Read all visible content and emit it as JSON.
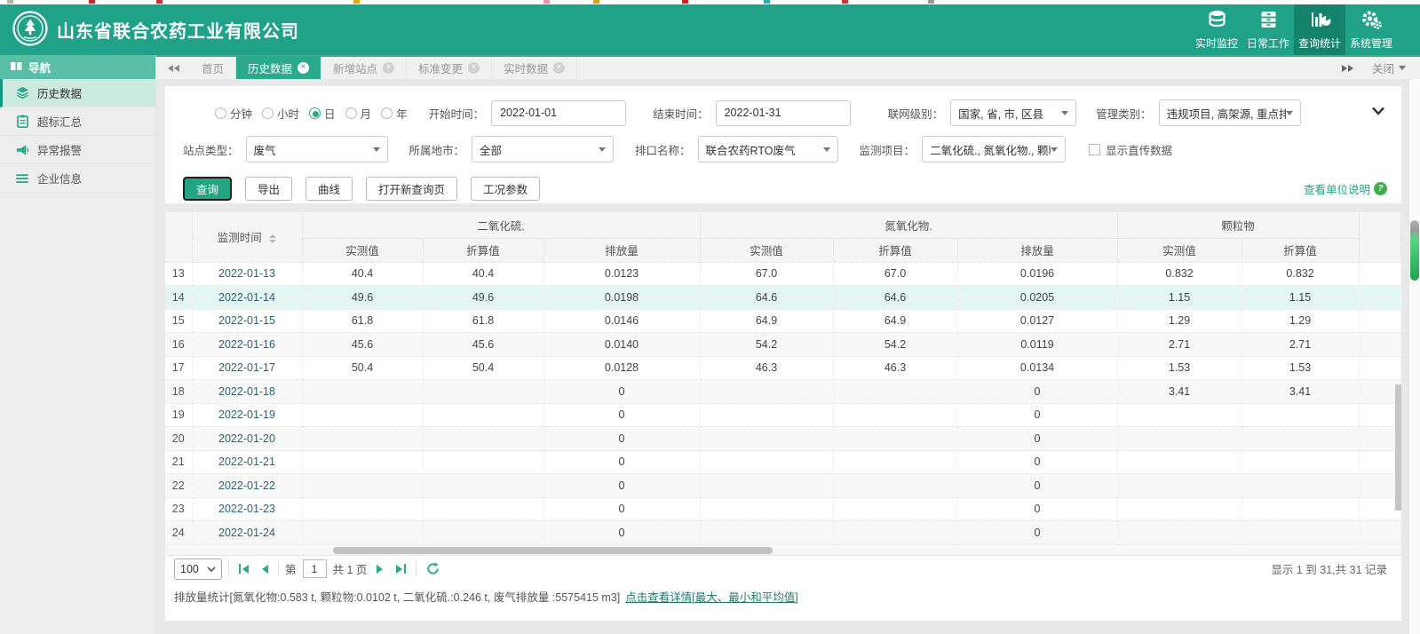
{
  "header": {
    "company_name": "山东省联合农药工业有限公司",
    "nav": [
      {
        "label": "实时监控"
      },
      {
        "label": "日常工作"
      },
      {
        "label": "查询统计"
      },
      {
        "label": "系统管理"
      }
    ]
  },
  "sidebar": {
    "title": "导航",
    "items": [
      {
        "label": "历史数据"
      },
      {
        "label": "超标汇总"
      },
      {
        "label": "异常报警"
      },
      {
        "label": "企业信息"
      }
    ]
  },
  "tabs": {
    "items": [
      {
        "label": "首页"
      },
      {
        "label": "历史数据"
      },
      {
        "label": "新增站点"
      },
      {
        "label": "标准变更"
      },
      {
        "label": "实时数据"
      }
    ],
    "close_menu": "关闭"
  },
  "filters": {
    "period": [
      {
        "label": "分钟",
        "selected": false
      },
      {
        "label": "小时",
        "selected": false
      },
      {
        "label": "日",
        "selected": true
      },
      {
        "label": "月",
        "selected": false
      },
      {
        "label": "年",
        "selected": false
      }
    ],
    "start_label": "开始时间：",
    "start_value": "2022-01-01",
    "end_label": "结束时间：",
    "end_value": "2022-01-31",
    "network_label": "联网级别：",
    "network_value": "国家, 省, 市, 区县",
    "manage_label": "管理类别：",
    "manage_value": "违规项目, 高架源, 重点排",
    "station_label": "站点类型：",
    "station_value": "废气",
    "city_label": "所属地市：",
    "city_value": "全部",
    "outlet_label": "排口名称：",
    "outlet_value": "联合农药RTO废气",
    "items_label": "监测项目：",
    "items_value": "二氧化硫., 氮氧化物., 颗粒",
    "direct_label": "显示直传数据",
    "buttons": {
      "query": "查询",
      "export": "导出",
      "curve": "曲线",
      "new_page": "打开新查询页",
      "params": "工况参数"
    },
    "unit_link": "查看单位说明"
  },
  "table": {
    "time_col": "监测时间",
    "groups": [
      {
        "label": "二氧化硫.",
        "cols": [
          "实测值",
          "折算值",
          "排放量"
        ]
      },
      {
        "label": "氮氧化物.",
        "cols": [
          "实测值",
          "折算值",
          "排放量"
        ]
      },
      {
        "label": "颗粒物",
        "cols": [
          "实测值",
          "折算值"
        ]
      }
    ],
    "rows": [
      {
        "n": 13,
        "date": "2022-01-13",
        "values": [
          "40.4",
          "40.4",
          "0.0123",
          "67.0",
          "67.0",
          "0.0196",
          "0.832",
          "0.832"
        ],
        "highlight": false
      },
      {
        "n": 14,
        "date": "2022-01-14",
        "values": [
          "49.6",
          "49.6",
          "0.0198",
          "64.6",
          "64.6",
          "0.0205",
          "1.15",
          "1.15"
        ],
        "highlight": true
      },
      {
        "n": 15,
        "date": "2022-01-15",
        "values": [
          "61.8",
          "61.8",
          "0.0146",
          "64.9",
          "64.9",
          "0.0127",
          "1.29",
          "1.29"
        ],
        "highlight": false
      },
      {
        "n": 16,
        "date": "2022-01-16",
        "values": [
          "45.6",
          "45.6",
          "0.0140",
          "54.2",
          "54.2",
          "0.0119",
          "2.71",
          "2.71"
        ],
        "highlight": false
      },
      {
        "n": 17,
        "date": "2022-01-17",
        "values": [
          "50.4",
          "50.4",
          "0.0128",
          "46.3",
          "46.3",
          "0.0134",
          "1.53",
          "1.53"
        ],
        "highlight": false
      },
      {
        "n": 18,
        "date": "2022-01-18",
        "values": [
          "",
          "",
          "0",
          "",
          "",
          "0",
          "3.41",
          "3.41"
        ],
        "highlight": false
      },
      {
        "n": 19,
        "date": "2022-01-19",
        "values": [
          "",
          "",
          "0",
          "",
          "",
          "0",
          "",
          ""
        ],
        "highlight": false
      },
      {
        "n": 20,
        "date": "2022-01-20",
        "values": [
          "",
          "",
          "0",
          "",
          "",
          "0",
          "",
          ""
        ],
        "highlight": false
      },
      {
        "n": 21,
        "date": "2022-01-21",
        "values": [
          "",
          "",
          "0",
          "",
          "",
          "0",
          "",
          ""
        ],
        "highlight": false
      },
      {
        "n": 22,
        "date": "2022-01-22",
        "values": [
          "",
          "",
          "0",
          "",
          "",
          "0",
          "",
          ""
        ],
        "highlight": false
      },
      {
        "n": 23,
        "date": "2022-01-23",
        "values": [
          "",
          "",
          "0",
          "",
          "",
          "0",
          "",
          ""
        ],
        "highlight": false
      },
      {
        "n": 24,
        "date": "2022-01-24",
        "values": [
          "",
          "",
          "0",
          "",
          "",
          "0",
          "",
          ""
        ],
        "highlight": false
      }
    ]
  },
  "pagination": {
    "page_size": "100",
    "page_prefix": "第",
    "page_value": "1",
    "page_suffix": "共 1 页",
    "record_info": "显示 1 到 31,共 31 记录"
  },
  "footer": {
    "stats": "排放量统计[氮氧化物:0.583 t, 颗粒物:0.0102 t, 二氧化硫.:0.246 t, 废气排放量 :5575415 m3]",
    "detail_link": "点击查看详情[最大、最小和平均值]"
  },
  "colors": {
    "header_green": "#1fa287",
    "accent_teal": "#2aa98c",
    "primary_button": "#21a583",
    "highlight_row": "#e4f6f1",
    "date_text": "#2f6173"
  }
}
